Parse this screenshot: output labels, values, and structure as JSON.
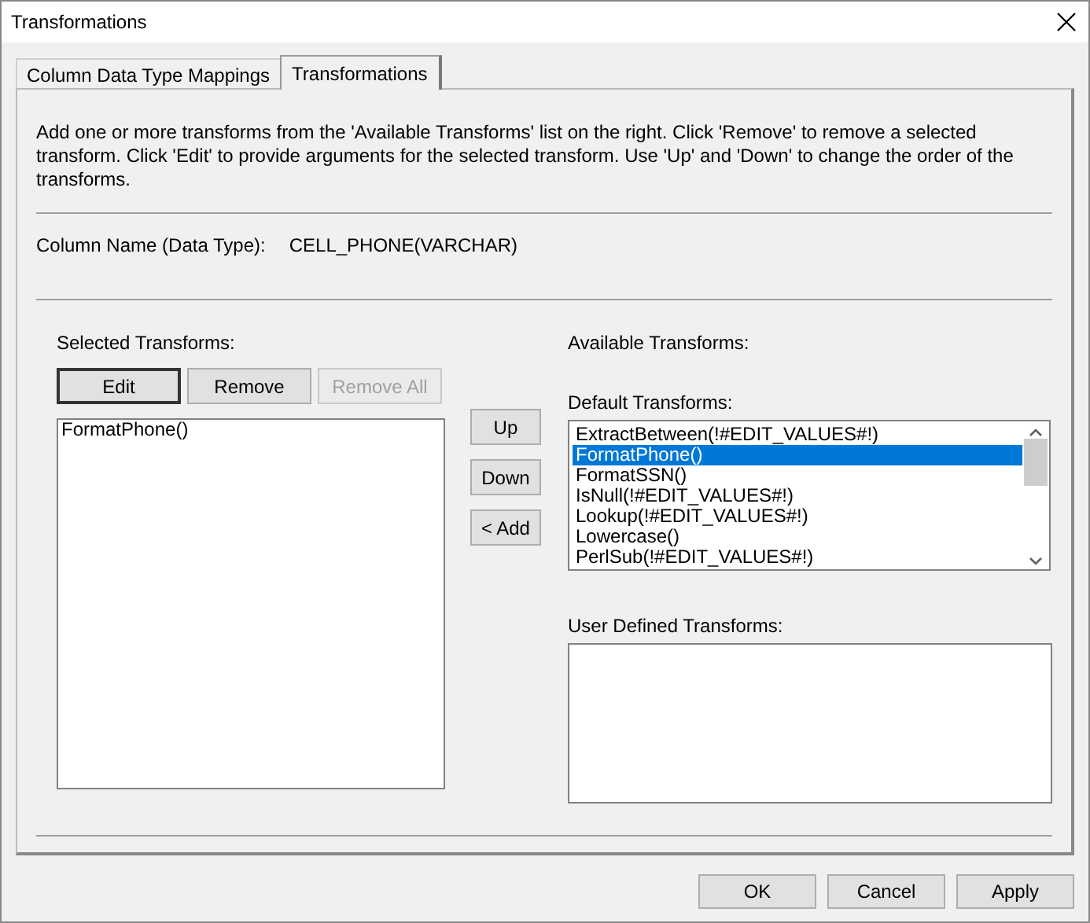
{
  "window": {
    "title": "Transformations"
  },
  "tabs": [
    {
      "label": "Column Data Type Mappings",
      "selected": false
    },
    {
      "label": "Transformations",
      "selected": true
    }
  ],
  "description": "Add one or more transforms from the 'Available Transforms' list on the right. Click 'Remove' to remove a selected transform. Click 'Edit' to provide arguments for the selected transform. Use 'Up' and 'Down' to change the order of the transforms.",
  "column_name": {
    "label": "Column Name (Data Type):",
    "value": "CELL_PHONE(VARCHAR)"
  },
  "selected_transforms": {
    "label": "Selected Transforms:",
    "buttons": [
      {
        "label": "Edit",
        "focused": true,
        "disabled": false
      },
      {
        "label": "Remove",
        "focused": false,
        "disabled": false
      },
      {
        "label": "Remove All",
        "focused": false,
        "disabled": true
      }
    ],
    "items": [
      {
        "label": "FormatPhone()",
        "selected": false
      }
    ]
  },
  "order_buttons": [
    {
      "label": "Up",
      "disabled": false
    },
    {
      "label": "Down",
      "disabled": false
    }
  ],
  "add_button": {
    "label": "< Add",
    "disabled": false
  },
  "available_transforms": {
    "label": "Available Transforms:",
    "default_label": "Default Transforms:",
    "default_items": [
      {
        "label": "ExtractBetween(!#EDIT_VALUES#!)",
        "selected": false
      },
      {
        "label": "FormatPhone()",
        "selected": true
      },
      {
        "label": "FormatSSN()",
        "selected": false
      },
      {
        "label": "IsNull(!#EDIT_VALUES#!)",
        "selected": false
      },
      {
        "label": "Lookup(!#EDIT_VALUES#!)",
        "selected": false
      },
      {
        "label": "Lowercase()",
        "selected": false
      },
      {
        "label": "PerlSub(!#EDIT_VALUES#!)",
        "selected": false
      }
    ],
    "user_label": "User Defined Transforms:"
  },
  "footer_buttons": [
    {
      "label": "OK",
      "disabled": false
    },
    {
      "label": "Cancel",
      "disabled": false
    },
    {
      "label": "Apply",
      "disabled": false
    }
  ]
}
